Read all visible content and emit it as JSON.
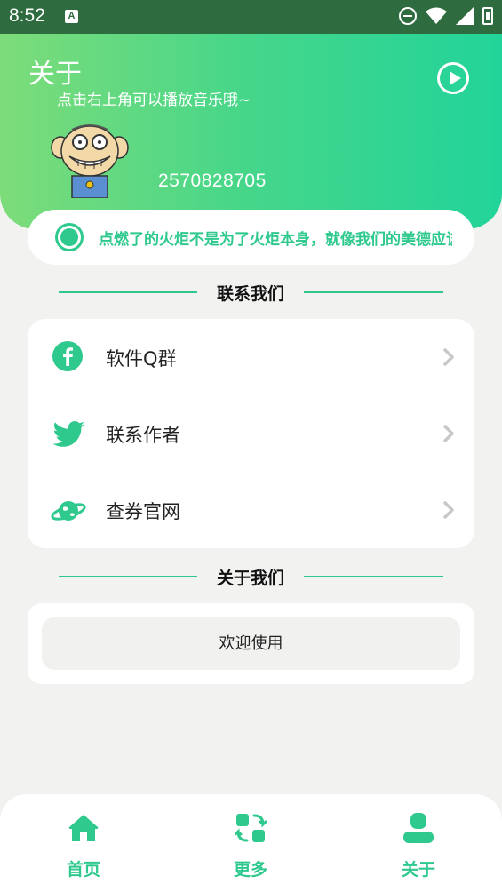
{
  "status_bar": {
    "time": "8:52",
    "notification_badge": "A"
  },
  "header": {
    "title": "关于",
    "subtitle": "点击右上角可以播放音乐哦~",
    "user_id": "2570828705"
  },
  "marquee": {
    "text": "点燃了的火炬不是为了火炬本身，就像我们的美德应该超过自己照亮别人"
  },
  "contact_section": {
    "title": "联系我们",
    "items": [
      {
        "label": "软件Q群",
        "icon": "facebook-icon"
      },
      {
        "label": "联系作者",
        "icon": "twitter-icon"
      },
      {
        "label": "查券官网",
        "icon": "planet-icon"
      }
    ]
  },
  "about_section": {
    "title": "关于我们",
    "welcome": "欢迎使用"
  },
  "bottom_nav": {
    "items": [
      {
        "label": "首页",
        "icon": "home-icon"
      },
      {
        "label": "更多",
        "icon": "swap-icon"
      },
      {
        "label": "关于",
        "icon": "user-icon"
      }
    ]
  },
  "colors": {
    "accent": "#2fc98e",
    "gradient_start": "#7ddc79",
    "gradient_end": "#22d49a",
    "background": "#f2f3f1",
    "status_bar": "#2e6b3f"
  }
}
